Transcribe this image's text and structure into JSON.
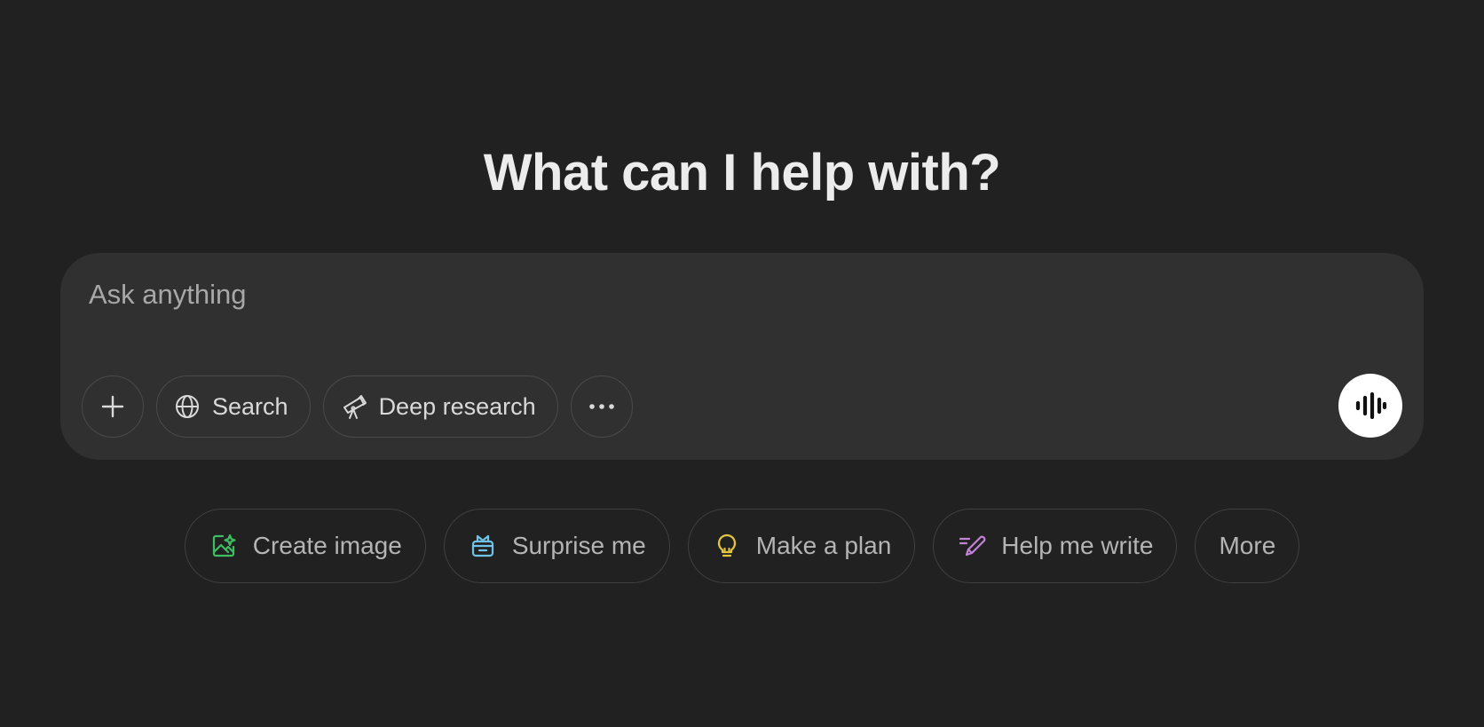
{
  "headline": "What can I help with?",
  "composer": {
    "placeholder": "Ask anything",
    "value": "",
    "tools": {
      "add_icon": "plus-icon",
      "search_label": "Search",
      "search_icon": "globe-icon",
      "deep_research_label": "Deep research",
      "deep_research_icon": "telescope-icon",
      "more_tools_icon": "ellipsis-icon"
    },
    "voice_icon": "voice-waveform-icon"
  },
  "suggestions": [
    {
      "label": "Create image",
      "icon": "image-sparkle-icon",
      "color": "#3ebd61"
    },
    {
      "label": "Surprise me",
      "icon": "gift-box-icon",
      "color": "#6fc4e8"
    },
    {
      "label": "Make a plan",
      "icon": "lightbulb-icon",
      "color": "#e2c541"
    },
    {
      "label": "Help me write",
      "icon": "pen-icon",
      "color": "#c283d6"
    },
    {
      "label": "More",
      "icon": "",
      "color": ""
    }
  ],
  "colors": {
    "background": "#212121",
    "composer": "#303030",
    "headline": "#ececec"
  }
}
